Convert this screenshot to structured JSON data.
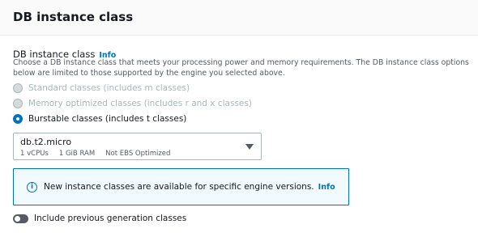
{
  "section": {
    "title": "DB instance class"
  },
  "field": {
    "label": "DB instance class",
    "info": "Info",
    "description": "Choose a DB instance class that meets your processing power and memory requirements. The DB instance class options below are limited to those supported by the engine you selected above."
  },
  "classes": [
    {
      "label": "Standard classes (includes m classes)",
      "selected": false,
      "disabled": true
    },
    {
      "label": "Memory optimized classes (includes r and x classes)",
      "selected": false,
      "disabled": true
    },
    {
      "label": "Burstable classes (includes t classes)",
      "selected": true,
      "disabled": false
    }
  ],
  "instance_select": {
    "value": "db.t2.micro",
    "vcpus": "1 vCPUs",
    "ram": "1 GiB RAM",
    "ebs": "Not EBS Optimized"
  },
  "alert": {
    "icon": "info-circle-icon",
    "text": "New instance classes are available for specific engine versions.",
    "info": "Info"
  },
  "toggle": {
    "label": "Include previous generation classes",
    "checked": false
  },
  "colors": {
    "accent": "#0073bb",
    "alert_bg": "#f1faff",
    "text": "#16191f",
    "muted": "#545b64",
    "disabled": "#aab7b8"
  }
}
